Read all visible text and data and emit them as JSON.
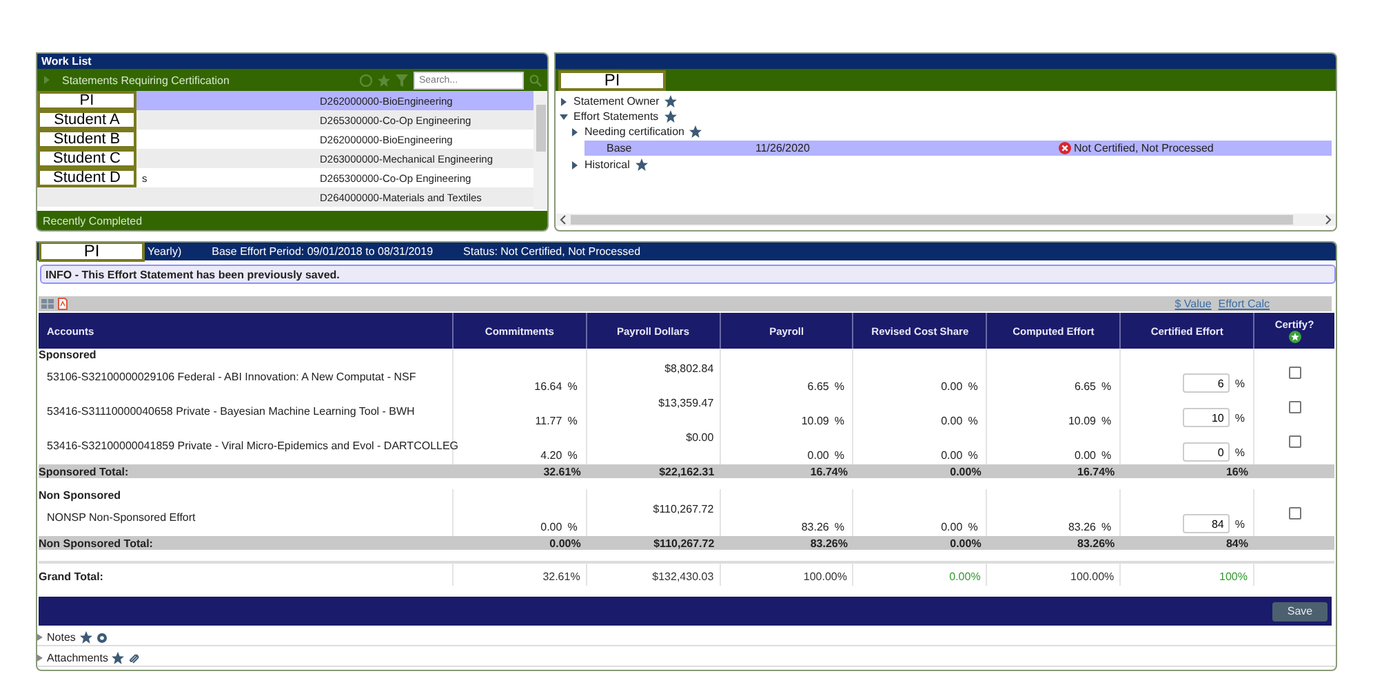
{
  "worklist": {
    "title": "Work List",
    "section": "Statements Requiring Certification",
    "search": {
      "placeholder": "Search..."
    },
    "rows": [
      {
        "name": "PI",
        "department": "D262000000-BioEngineering",
        "selected": true
      },
      {
        "name": "Student A",
        "department": "D265300000-Co-Op Engineering",
        "selected": false
      },
      {
        "name": "Student B",
        "department": "D262000000-BioEngineering",
        "selected": false
      },
      {
        "name": "Student C",
        "department": "D263000000-Mechanical Engineering",
        "selected": false
      },
      {
        "name": "Student D",
        "name_tail": "s",
        "department": "D265300000-Co-Op Engineering",
        "selected": false
      },
      {
        "department": "D264000000-Materials and Textiles",
        "selected": false
      }
    ],
    "footer": "Recently Completed"
  },
  "statement_panel": {
    "label": "PI",
    "tree": [
      {
        "label": "Statement Owner",
        "expanded": false
      },
      {
        "label": "Effort Statements",
        "expanded": true,
        "children": [
          {
            "label": "Needing certification",
            "expanded": false,
            "rows": [
              {
                "type": "Base",
                "date": "11/26/2020",
                "status": "Not Certified, Not Processed",
                "selected": true
              }
            ]
          },
          {
            "label": "Historical",
            "expanded": false
          }
        ]
      }
    ]
  },
  "effort": {
    "label": "PI",
    "period_type": "Yearly)",
    "period": "Base Effort Period: 09/01/2018 to 08/31/2019",
    "status": "Status: Not Certified, Not Processed",
    "info": "INFO - This Effort Statement has been previously saved.",
    "links": [
      "$ Value",
      "Effort Calc"
    ],
    "columns": [
      "Accounts",
      "Commitments",
      "Payroll Dollars",
      "Payroll",
      "Revised Cost Share",
      "Computed Effort",
      "Certified Effort",
      "Certify?"
    ],
    "groups": [
      {
        "title": "Sponsored",
        "rows": [
          {
            "account": "53106-S32100000029106 Federal - ABI Innovation: A New Computat - NSF",
            "commitments": "16.64",
            "payroll_dollars": "$8,802.84",
            "payroll": "6.65",
            "revised": "0.00",
            "computed": "6.65",
            "certified": "6",
            "checked": false
          },
          {
            "account": "53416-S31110000040658 Private - Bayesian Machine Learning Tool - BWH",
            "commitments": "11.77",
            "payroll_dollars": "$13,359.47",
            "payroll": "10.09",
            "revised": "0.00",
            "computed": "10.09",
            "certified": "10",
            "checked": false
          },
          {
            "account": "53416-S32100000041859 Private - Viral Micro-Epidemics and Evol - DARTCOLLEG",
            "commitments": "4.20",
            "payroll_dollars": "$0.00",
            "payroll": "0.00",
            "revised": "0.00",
            "computed": "0.00",
            "certified": "0",
            "checked": false
          }
        ],
        "total": {
          "label": "Sponsored Total:",
          "values": [
            "32.61%",
            "$22,162.31",
            "16.74%",
            "0.00%",
            "16.74%",
            "16%"
          ]
        }
      },
      {
        "title": "Non Sponsored",
        "rows": [
          {
            "account": "NONSP Non-Sponsored Effort",
            "commitments": "0.00",
            "payroll_dollars": "$110,267.72",
            "payroll": "83.26",
            "revised": "0.00",
            "computed": "83.26",
            "certified": "84",
            "checked": false
          }
        ],
        "total": {
          "label": "Non Sponsored Total:",
          "values": [
            "0.00%",
            "$110,267.72",
            "83.26%",
            "0.00%",
            "83.26%",
            "84%"
          ]
        }
      }
    ],
    "grand_total": {
      "label": "Grand Total:",
      "values": [
        {
          "text": "32.61%",
          "color": "#333333"
        },
        {
          "text": "$132,430.03",
          "color": "#333333"
        },
        {
          "text": "100.00%",
          "color": "#333333"
        },
        {
          "text": "0.00%",
          "color": "#339933"
        },
        {
          "text": "100.00%",
          "color": "#333333"
        },
        {
          "text": "100%",
          "color": "#339933"
        }
      ]
    },
    "percent_sign": "%",
    "save": "Save",
    "sections": [
      {
        "label": "Notes",
        "kind": "notes"
      },
      {
        "label": "Attachments",
        "kind": "attachments"
      }
    ]
  }
}
